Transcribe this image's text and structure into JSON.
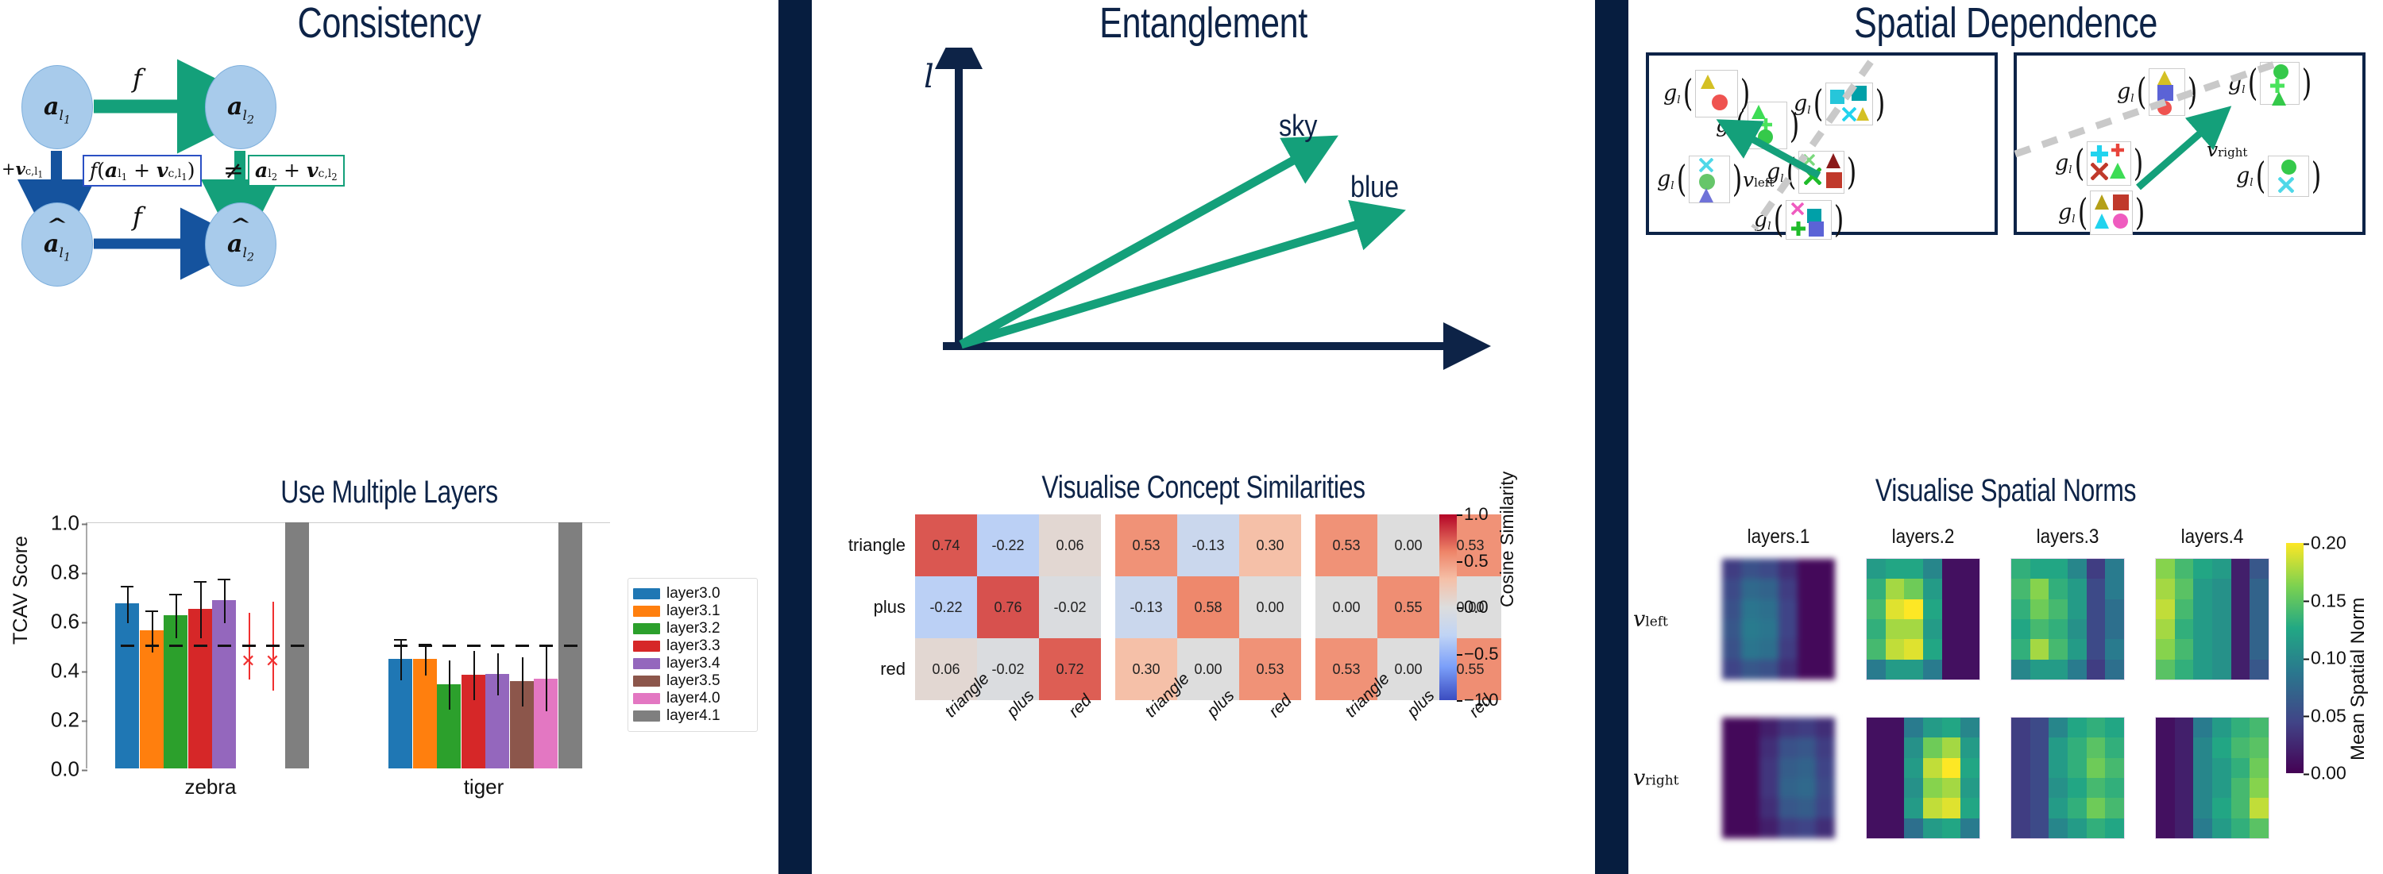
{
  "panels": {
    "consistency": {
      "title": "Consistency",
      "subtitle": "Use Multiple Layers",
      "nodes": [
        {
          "id": "a-l1",
          "base": "a",
          "sub": "l₁",
          "hat": false
        },
        {
          "id": "a-l2",
          "base": "a",
          "sub": "l₂",
          "hat": false
        },
        {
          "id": "ahat-l1",
          "base": "a",
          "sub": "l₁",
          "hat": true
        },
        {
          "id": "ahat-l2",
          "base": "a",
          "sub": "l₂",
          "hat": true
        }
      ],
      "arrow_top_label": "f",
      "arrow_bottom_label": "f",
      "left_vector_label": "+v",
      "left_vector_sub": "c,l₁",
      "right_vector_label": "+v",
      "right_vector_sub": "c,l₂",
      "equation_left": "f(a",
      "equation_left_sub1": "l₁",
      "equation_left_mid": " + v",
      "equation_left_sub2": "c,l₁",
      "equation_left_end": ")",
      "equation_neq": "≠",
      "equation_right": "a",
      "equation_right_sub1": "l₂",
      "equation_right_mid": " + v",
      "equation_right_sub2": "c,l₂",
      "colors": {
        "node_fill": "#a8cbeb",
        "green": "#14a07a",
        "blue": "#15539e",
        "navy": "#0d2347"
      }
    },
    "entanglement": {
      "title": "Entanglement",
      "subtitle": "Visualise Concept Similarities",
      "axis_label": "l",
      "vectors": [
        {
          "label": "sky",
          "angle_deg": 47
        },
        {
          "label": "blue",
          "angle_deg": 31
        }
      ],
      "arrow_color": "#14a07a",
      "axis_color": "#0d2347"
    },
    "spatial": {
      "title": "Spatial Dependence",
      "subtitle": "Visualise Spatial Norms",
      "left_vector_label": "v",
      "left_vector_sub": "left",
      "right_vector_label": "v",
      "right_vector_sub": "right",
      "gl_symbol": "g",
      "gl_sub": "l",
      "box_border_color": "#0d2347",
      "dash_color": "#c9c9c9",
      "arrow_color": "#14a07a"
    }
  },
  "chart_data": [
    {
      "type": "bar",
      "title": "Use Multiple Layers",
      "xlabel": "",
      "ylabel": "TCAV Score",
      "ylim": [
        0.0,
        1.0
      ],
      "yticks": [
        "0.0",
        "0.2",
        "0.4",
        "0.6",
        "0.8",
        "1.0"
      ],
      "categories": [
        "zebra",
        "tiger"
      ],
      "series": [
        {
          "name": "layer3.0",
          "color": "#1f77b4",
          "values": [
            0.67,
            0.445
          ],
          "err": [
            0.075,
            0.085
          ],
          "sig": [
            true,
            true
          ]
        },
        {
          "name": "layer3.1",
          "color": "#ff7f0e",
          "values": [
            0.56,
            0.445
          ],
          "err": [
            0.085,
            0.065
          ],
          "sig": [
            true,
            true
          ]
        },
        {
          "name": "layer3.2",
          "color": "#2ca02c",
          "values": [
            0.622,
            0.342
          ],
          "err": [
            0.09,
            0.1
          ],
          "sig": [
            true,
            false
          ]
        },
        {
          "name": "layer3.3",
          "color": "#d62728",
          "values": [
            0.648,
            0.38
          ],
          "err": [
            0.115,
            0.1
          ],
          "sig": [
            true,
            false
          ]
        },
        {
          "name": "layer3.4",
          "color": "#9467bd",
          "values": [
            0.684,
            0.385
          ],
          "err": [
            0.09,
            0.085
          ],
          "sig": [
            true,
            false
          ]
        },
        {
          "name": "layer3.5",
          "color": "#8c564b",
          "values": [
            null,
            0.354
          ],
          "err": [
            0.135,
            0.1
          ],
          "sig": [
            false,
            false
          ]
        },
        {
          "name": "layer4.0",
          "color": "#e377c2",
          "values": [
            null,
            0.366
          ],
          "err": [
            0.18,
            0.13
          ],
          "sig": [
            false,
            false
          ]
        },
        {
          "name": "layer4.1",
          "color": "#7f7f7f",
          "values": [
            1.0,
            1.0
          ],
          "err": [
            0.0,
            0.0
          ],
          "sig": [
            false,
            false
          ]
        }
      ],
      "legend_position": "right",
      "grid": false,
      "notes": "zebra: layer3.5 and layer4.0 shown as red whisker + red x (non-significant, no bar)"
    },
    {
      "type": "heatmap",
      "title": "Visualise Concept Similarities",
      "cbar_label": "Cosine Similarity",
      "cbar_ticks": [
        "1.0",
        "0.5",
        "0.0",
        "-0.5",
        "-1.0"
      ],
      "vmin": -1.0,
      "vmax": 1.0,
      "cmap": "coolwarm",
      "rows": [
        "triangle",
        "plus",
        "red"
      ],
      "blocks": [
        {
          "cols": [
            "triangle",
            "plus",
            "red"
          ],
          "values": [
            [
              0.74,
              -0.22,
              0.06
            ],
            [
              -0.22,
              0.76,
              -0.02
            ],
            [
              0.06,
              -0.02,
              0.72
            ]
          ]
        },
        {
          "cols": [
            "triangle",
            "plus",
            "red"
          ],
          "values": [
            [
              0.53,
              -0.13,
              0.3
            ],
            [
              -0.13,
              0.58,
              0.0
            ],
            [
              0.3,
              0.0,
              0.53
            ]
          ]
        },
        {
          "cols": [
            "triangle",
            "plus",
            "red"
          ],
          "values": [
            [
              0.53,
              0.0,
              0.53
            ],
            [
              0.0,
              0.55,
              0.0
            ],
            [
              0.53,
              0.0,
              0.55
            ]
          ]
        }
      ]
    },
    {
      "type": "heatmap",
      "title": "Visualise Spatial Norms",
      "cbar_label": "Mean Spatial Norm",
      "cbar_ticks": [
        "0.20",
        "0.15",
        "0.10",
        "0.05",
        "0.00"
      ],
      "vmin": 0.0,
      "vmax": 0.22,
      "cmap": "viridis",
      "columns": [
        "layers.1",
        "layers.2",
        "layers.3",
        "layers.4"
      ],
      "rows": [
        "v_left",
        "v_right"
      ],
      "maps": [
        {
          "row": "v_left",
          "col": "layers.1",
          "grid": [
            [
              0.04,
              0.055,
              0.05,
              0.03,
              0.005,
              0.005
            ],
            [
              0.05,
              0.075,
              0.07,
              0.04,
              0.005,
              0.005
            ],
            [
              0.055,
              0.085,
              0.08,
              0.045,
              0.005,
              0.005
            ],
            [
              0.06,
              0.09,
              0.085,
              0.045,
              0.005,
              0.005
            ],
            [
              0.055,
              0.085,
              0.08,
              0.04,
              0.005,
              0.005
            ],
            [
              0.045,
              0.06,
              0.055,
              0.03,
              0.005,
              0.005
            ]
          ]
        },
        {
          "row": "v_left",
          "col": "layers.2",
          "grid": [
            [
              0.12,
              0.13,
              0.13,
              0.1,
              0.01,
              0.01
            ],
            [
              0.14,
              0.19,
              0.17,
              0.12,
              0.01,
              0.01
            ],
            [
              0.15,
              0.21,
              0.22,
              0.13,
              0.01,
              0.01
            ],
            [
              0.14,
              0.19,
              0.19,
              0.12,
              0.01,
              0.01
            ],
            [
              0.15,
              0.2,
              0.21,
              0.13,
              0.01,
              0.01
            ],
            [
              0.09,
              0.12,
              0.12,
              0.09,
              0.01,
              0.01
            ]
          ]
        },
        {
          "row": "v_left",
          "col": "layers.3",
          "grid": [
            [
              0.14,
              0.13,
              0.13,
              0.1,
              0.04,
              0.09
            ],
            [
              0.15,
              0.18,
              0.14,
              0.12,
              0.05,
              0.09
            ],
            [
              0.14,
              0.17,
              0.15,
              0.12,
              0.05,
              0.08
            ],
            [
              0.13,
              0.15,
              0.14,
              0.11,
              0.05,
              0.08
            ],
            [
              0.14,
              0.19,
              0.15,
              0.12,
              0.05,
              0.09
            ],
            [
              0.1,
              0.12,
              0.12,
              0.09,
              0.04,
              0.08
            ]
          ]
        },
        {
          "row": "v_left",
          "col": "layers.4",
          "grid": [
            [
              0.18,
              0.15,
              0.13,
              0.12,
              0.02,
              0.06
            ],
            [
              0.19,
              0.16,
              0.12,
              0.11,
              0.02,
              0.07
            ],
            [
              0.2,
              0.15,
              0.12,
              0.11,
              0.02,
              0.07
            ],
            [
              0.19,
              0.14,
              0.12,
              0.11,
              0.02,
              0.07
            ],
            [
              0.18,
              0.15,
              0.12,
              0.11,
              0.02,
              0.07
            ],
            [
              0.16,
              0.14,
              0.12,
              0.11,
              0.02,
              0.06
            ]
          ]
        },
        {
          "row": "v_right",
          "col": "layers.1",
          "grid": [
            [
              0.005,
              0.005,
              0.02,
              0.035,
              0.04,
              0.03
            ],
            [
              0.005,
              0.005,
              0.03,
              0.055,
              0.06,
              0.04
            ],
            [
              0.005,
              0.005,
              0.035,
              0.065,
              0.07,
              0.045
            ],
            [
              0.005,
              0.005,
              0.035,
              0.07,
              0.075,
              0.05
            ],
            [
              0.005,
              0.005,
              0.03,
              0.06,
              0.065,
              0.045
            ],
            [
              0.005,
              0.005,
              0.02,
              0.04,
              0.045,
              0.03
            ]
          ]
        },
        {
          "row": "v_right",
          "col": "layers.2",
          "grid": [
            [
              0.01,
              0.01,
              0.09,
              0.12,
              0.13,
              0.1
            ],
            [
              0.01,
              0.01,
              0.11,
              0.17,
              0.19,
              0.12
            ],
            [
              0.01,
              0.01,
              0.12,
              0.2,
              0.22,
              0.13
            ],
            [
              0.01,
              0.01,
              0.11,
              0.18,
              0.19,
              0.12
            ],
            [
              0.01,
              0.01,
              0.12,
              0.2,
              0.21,
              0.13
            ],
            [
              0.01,
              0.01,
              0.08,
              0.12,
              0.13,
              0.09
            ]
          ]
        },
        {
          "row": "v_right",
          "col": "layers.3",
          "grid": [
            [
              0.04,
              0.05,
              0.1,
              0.13,
              0.14,
              0.13
            ],
            [
              0.04,
              0.05,
              0.12,
              0.14,
              0.16,
              0.14
            ],
            [
              0.04,
              0.05,
              0.12,
              0.14,
              0.17,
              0.15
            ],
            [
              0.04,
              0.05,
              0.11,
              0.13,
              0.15,
              0.14
            ],
            [
              0.04,
              0.05,
              0.12,
              0.14,
              0.17,
              0.15
            ],
            [
              0.04,
              0.05,
              0.1,
              0.12,
              0.14,
              0.13
            ]
          ]
        },
        {
          "row": "v_right",
          "col": "layers.4",
          "grid": [
            [
              0.01,
              0.02,
              0.09,
              0.12,
              0.14,
              0.15
            ],
            [
              0.01,
              0.02,
              0.1,
              0.13,
              0.15,
              0.16
            ],
            [
              0.01,
              0.02,
              0.1,
              0.12,
              0.14,
              0.17
            ],
            [
              0.01,
              0.02,
              0.1,
              0.12,
              0.15,
              0.18
            ],
            [
              0.01,
              0.02,
              0.1,
              0.13,
              0.15,
              0.2
            ],
            [
              0.01,
              0.02,
              0.09,
              0.12,
              0.14,
              0.16
            ]
          ]
        }
      ]
    }
  ]
}
